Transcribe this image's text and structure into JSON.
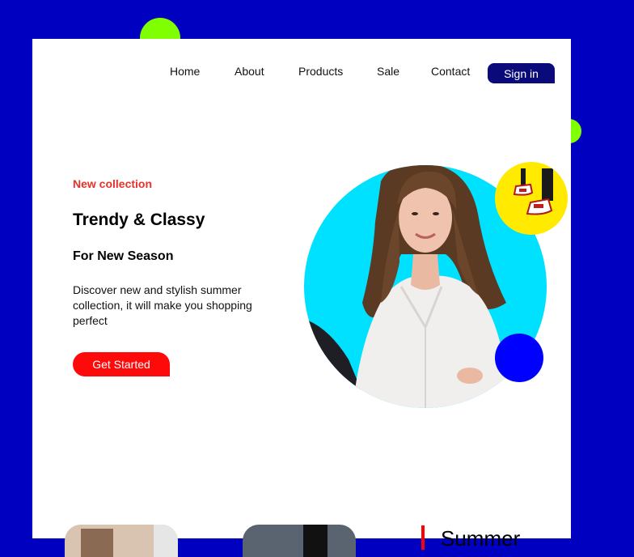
{
  "nav": {
    "items": [
      "Home",
      "About",
      "Products",
      "Sale",
      "Contact"
    ],
    "signin_label": "Sign in"
  },
  "hero": {
    "eyebrow": "New collection",
    "title": "Trendy & Classy",
    "subtitle": "For New Season",
    "description": "Discover new and stylish summer collection, it will make you shopping perfect",
    "cta_label": "Get Started"
  },
  "section": {
    "heading": "Summer"
  },
  "colors": {
    "background": "#0000c0",
    "accent_red": "#ff0a0a",
    "accent_green": "#80ff00",
    "accent_yellow": "#ffea00",
    "accent_cyan": "#00e0ff",
    "accent_blue": "#0000ff",
    "nav_button": "#0a0a7a"
  }
}
